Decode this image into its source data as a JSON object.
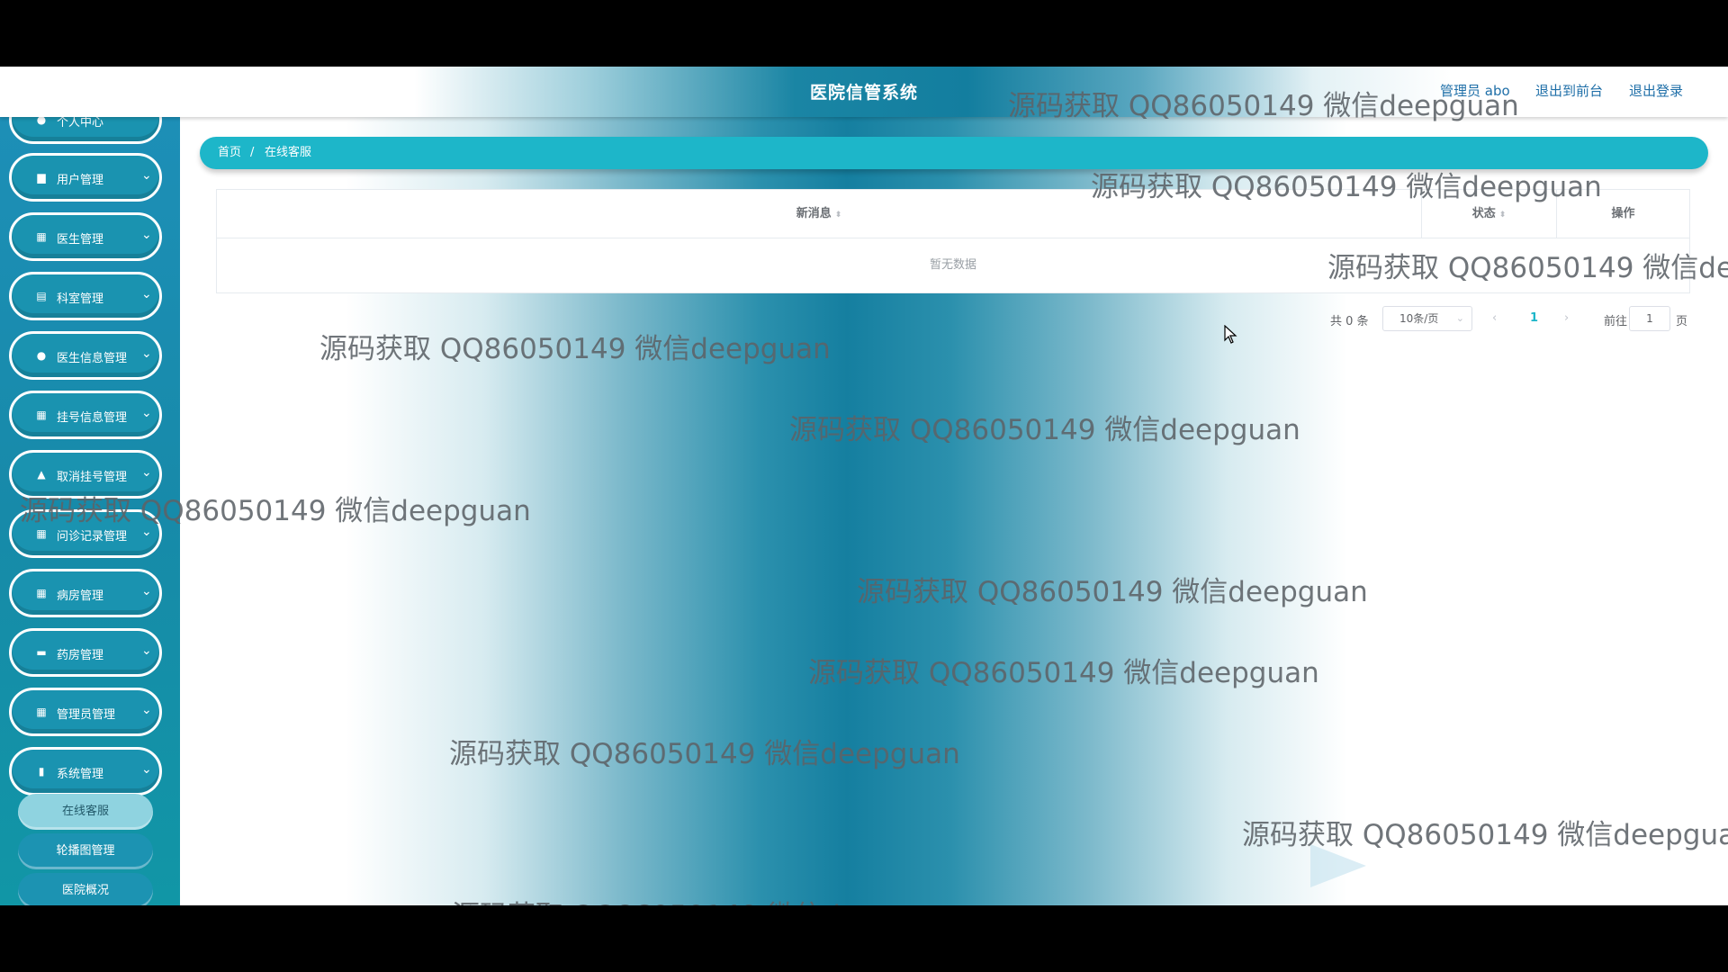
{
  "header": {
    "title": "医院信管系统",
    "admin_label": "管理员 abo",
    "front_link": "退出到前台",
    "logout_link": "退出登录"
  },
  "sidebar": {
    "items": [
      {
        "label": "个人中心",
        "icon": "person-icon"
      },
      {
        "label": "用户管理",
        "icon": "users-icon"
      },
      {
        "label": "医生管理",
        "icon": "grid-icon"
      },
      {
        "label": "科室管理",
        "icon": "clipboard-icon"
      },
      {
        "label": "医生信息管理",
        "icon": "person-icon"
      },
      {
        "label": "挂号信息管理",
        "icon": "grid-icon"
      },
      {
        "label": "取消挂号管理",
        "icon": "thumb-icon"
      },
      {
        "label": "问诊记录管理",
        "icon": "grid-icon"
      },
      {
        "label": "病房管理",
        "icon": "grid-icon"
      },
      {
        "label": "药房管理",
        "icon": "pharmacy-icon"
      },
      {
        "label": "管理员管理",
        "icon": "grid-icon"
      },
      {
        "label": "系统管理",
        "icon": "book-icon"
      }
    ],
    "submenu": [
      {
        "label": "在线客服",
        "active": true
      },
      {
        "label": "轮播图管理",
        "active": false
      },
      {
        "label": "医院概况",
        "active": false
      }
    ]
  },
  "breadcrumb": {
    "home": "首页",
    "separator": "/",
    "current": "在线客服"
  },
  "table": {
    "columns": [
      "新消息",
      "状态",
      "操作"
    ],
    "empty_text": "暂无数据"
  },
  "pagination": {
    "total": "共 0 条",
    "page_size": "10条/页",
    "current_page": "1",
    "goto_label": "前往",
    "goto_value": "1",
    "page_suffix": "页"
  },
  "watermark": {
    "text": "源码获取 QQ86050149 微信deepguan",
    "text_cut": "源码获取 QQ86050149 微信dee"
  },
  "colors": {
    "accent": "#1db6c9",
    "sidebar": "#178aa9",
    "header_link": "#1f6fa8"
  }
}
